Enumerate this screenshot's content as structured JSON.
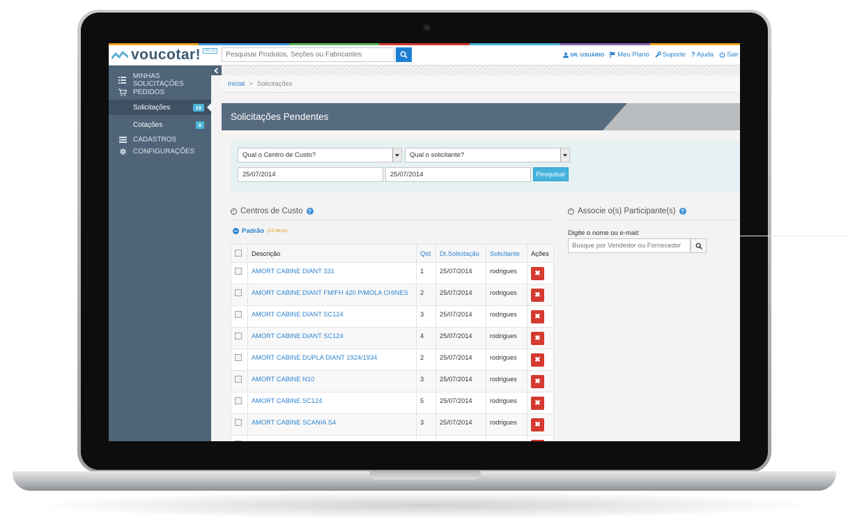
{
  "colors": {
    "accent": "#2c83cf",
    "sidebar": "#4f6478",
    "header": "#566b7e",
    "badge": "#4bb3d8",
    "delete": "#d43a2f",
    "strip": [
      "#f2a81d",
      "#3b8fd8",
      "#5bb75b",
      "#d43a2f",
      "#4bb3d8",
      "#8a63b3",
      "#f2a81d"
    ]
  },
  "topbar": {
    "logo": "voucotar!",
    "beta": "BETA",
    "search_placeholder": "Pesquisar Produtos, Seções ou Fabricantes",
    "links": {
      "user": "SR. USUÁRIO",
      "plan": "Meu Plano",
      "support": "Suporte",
      "help": "Ajuda",
      "exit": "Sair"
    }
  },
  "sidebar": {
    "minhas": "MINHAS SOLICITAÇÕES",
    "pedidos": "PEDIDOS",
    "solicitacoes": {
      "label": "Solicitações",
      "count": "10"
    },
    "cotacoes": {
      "label": "Cotações",
      "count": "0"
    },
    "cadastros": "CADASTROS",
    "configuracoes": "CONFIGURAÇÕES"
  },
  "breadcrumb": {
    "home": "Inicial",
    "sep": ">",
    "current": "Solicitações"
  },
  "page_title": "Solicitações Pendentes",
  "filters": {
    "centro_custo": "Qual o Centro de Custo?",
    "solicitante": "Qual o solicitante?",
    "date_from": "25/07/2014",
    "date_to": "25/07/2014",
    "search_button": "Pesquisar"
  },
  "centros": {
    "title": "Centros de Custo",
    "group": "Padrão",
    "group_count": "(10 itens)",
    "columns": {
      "descricao": "Descrição",
      "qtd": "Qtd",
      "dt": "Dt.Solicitação",
      "solicitante": "Solicitante",
      "acoes": "Ações"
    },
    "rows": [
      {
        "desc": "AMORT CABINE DIANT 331",
        "qtd": "1",
        "date": "25/07/2014",
        "user": "rodrigues"
      },
      {
        "desc": "AMORT CABINE DIANT FM/FH 420 P/MOLA CHINES",
        "qtd": "2",
        "date": "25/07/2014",
        "user": "rodrigues"
      },
      {
        "desc": "AMORT CABINE DIANT SC124",
        "qtd": "3",
        "date": "25/07/2014",
        "user": "rodrigues"
      },
      {
        "desc": "AMORT CABINE DIANT SC124",
        "qtd": "4",
        "date": "25/07/2014",
        "user": "rodrigues"
      },
      {
        "desc": "AMORT CABINE DUPLA DIANT 1924/1934",
        "qtd": "2",
        "date": "25/07/2014",
        "user": "rodrigues"
      },
      {
        "desc": "AMORT CABINE N10",
        "qtd": "3",
        "date": "25/07/2014",
        "user": "rodrigues"
      },
      {
        "desc": "AMORT CABINE SC124",
        "qtd": "5",
        "date": "25/07/2014",
        "user": "rodrigues"
      },
      {
        "desc": "AMORT CABINE SCANIA S4",
        "qtd": "3",
        "date": "25/07/2014",
        "user": "rodrigues"
      }
    ]
  },
  "associe": {
    "title": "Associe o(s) Participante(s)",
    "label": "Digite o nome ou e-mail:",
    "placeholder": "Busque por Vendedor ou Fornecedor"
  }
}
